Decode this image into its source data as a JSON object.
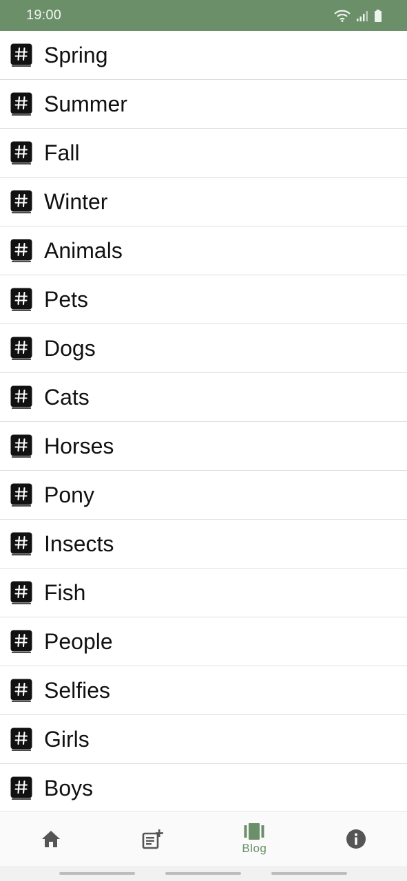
{
  "status_bar": {
    "time": "19:00"
  },
  "topics": [
    "Spring",
    "Summer",
    "Fall",
    "Winter",
    "Animals",
    "Pets",
    "Dogs",
    "Cats",
    "Horses",
    "Pony",
    "Insects",
    "Fish",
    "People",
    "Selfies",
    "Girls",
    "Boys"
  ],
  "bottom_nav": {
    "items": [
      {
        "icon": "home-icon",
        "label": ""
      },
      {
        "icon": "add-post-icon",
        "label": ""
      },
      {
        "icon": "blog-icon",
        "label": "Blog",
        "active": true
      },
      {
        "icon": "info-icon",
        "label": ""
      }
    ]
  },
  "colors": {
    "accent": "#6a8f69",
    "nav_icon": "#555555",
    "text": "#111111",
    "divider": "#dedede"
  }
}
